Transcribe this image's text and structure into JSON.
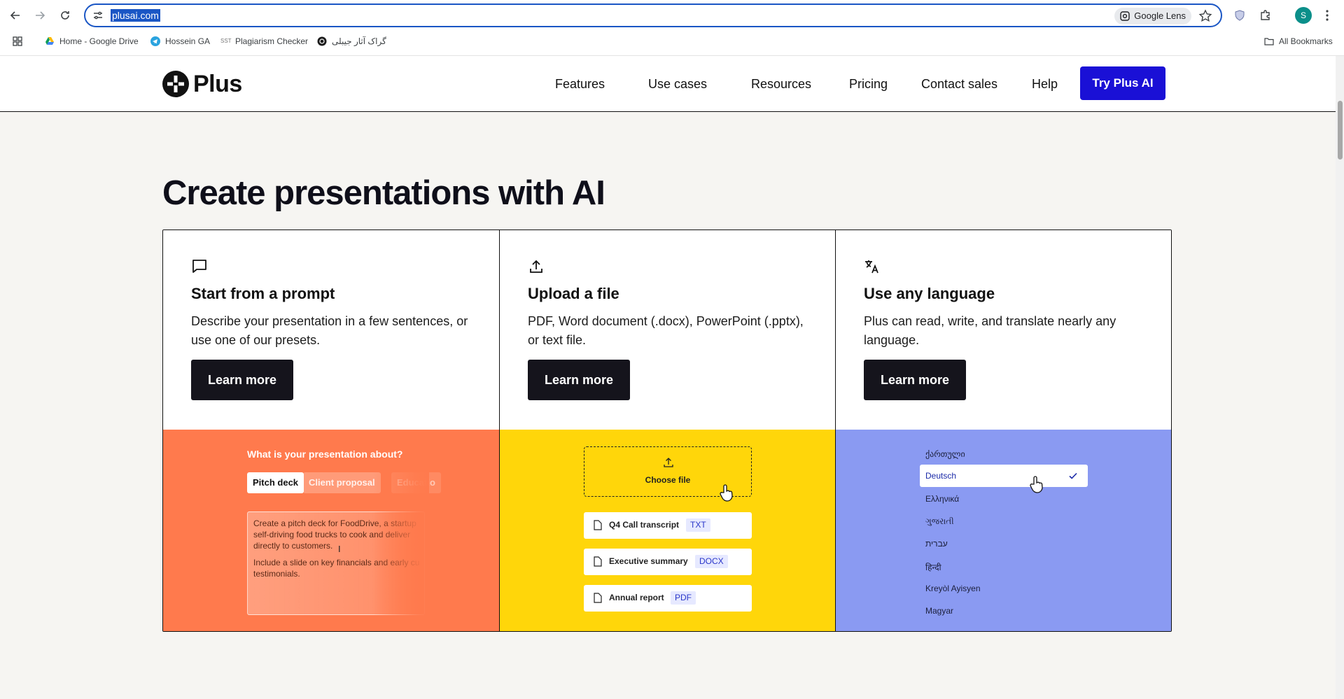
{
  "browser": {
    "url": "plusai.com",
    "lens_label": "Google Lens",
    "bookmarks": [
      {
        "label": "Home - Google Drive",
        "icon": "google-drive-icon"
      },
      {
        "label": "Hossein GA",
        "icon": "telegram-icon"
      },
      {
        "label": "Plagiarism Checker",
        "icon": "sst-icon"
      },
      {
        "label": "گراک آثار جیبلی",
        "icon": "openai-icon"
      }
    ],
    "all_bookmarks": "All Bookmarks",
    "profile_initial": "S"
  },
  "header": {
    "logo_text": "Plus",
    "nav": [
      "Features",
      "Use cases",
      "Resources",
      "Pricing",
      "Contact sales",
      "Help"
    ],
    "cta": "Try Plus AI"
  },
  "main": {
    "headline": "Create presentations with AI",
    "cards": [
      {
        "icon": "chat-bubble-icon",
        "title": "Start from a prompt",
        "description": "Describe your presentation in a few sentences, or use one of our presets.",
        "button": "Learn more"
      },
      {
        "icon": "upload-icon",
        "title": "Upload a file",
        "description": "PDF, Word document (.docx), PowerPoint (.pptx), or text file.",
        "button": "Learn more"
      },
      {
        "icon": "translate-icon",
        "title": "Use any language",
        "description": "Plus can read, write, and translate nearly any language.",
        "button": "Learn more"
      }
    ],
    "prompt_demo": {
      "question": "What is your presentation about?",
      "chips": [
        "Pitch deck",
        "Client proposal",
        "Educatio"
      ],
      "lines": [
        [
          "Create a pitch deck for FoodDrive, a startup",
          "self-driving food trucks to cook and deliver",
          "directly to customers."
        ],
        [
          "Include a slide on key financials and early cu",
          "testimonials."
        ]
      ]
    },
    "upload_demo": {
      "choose_label": "Choose file",
      "files": [
        {
          "name": "Q4 Call transcript",
          "type": "TXT"
        },
        {
          "name": "Executive summary",
          "type": "DOCX"
        },
        {
          "name": "Annual report",
          "type": "PDF"
        }
      ]
    },
    "language_demo": {
      "top": "ქართული",
      "selected": "Deutsch",
      "others": [
        "Ελληνικά",
        "ગુજરાતી",
        "עברית",
        "हिन्दी",
        "Kreyòl Ayisyen",
        "Magyar"
      ]
    }
  }
}
